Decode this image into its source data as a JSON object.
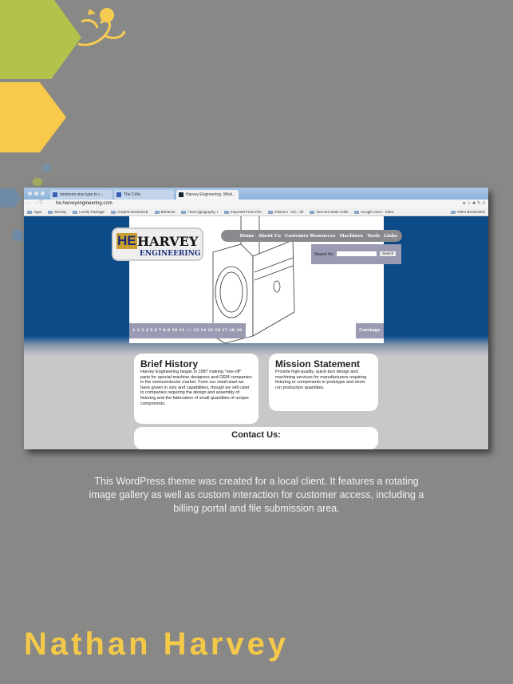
{
  "colors": {
    "background": "#888886",
    "green": "#b3c24b",
    "yellow": "#f8c94a",
    "blue": "#0c4a88"
  },
  "browser": {
    "tabs": [
      {
        "label": "minimum size type to r..."
      },
      {
        "label": "The Critic"
      },
      {
        "label": "Harvey Engineering, Wind..."
      }
    ],
    "url": "he.harveyengineering.com",
    "bookmarks": [
      "Apps",
      "Barclay",
      "Lovely Package",
      "Graphic-ExchanCE",
      "Behance",
      "I love typography, t",
      "Imported From Fire",
      "Volume I - DC : All",
      "Vermont State Colle",
      "Google Voice - Inbox",
      "Other Bookmarks"
    ]
  },
  "site": {
    "logo": {
      "initials": "HE",
      "name": "HARVEY",
      "sub": "ENGINEERING"
    },
    "nav": [
      "Home",
      "About Us",
      "Customer Resources",
      "Machines",
      "Tools",
      "Links"
    ],
    "search": {
      "label": "Search for:",
      "button": "Search",
      "value": ""
    },
    "gallery": {
      "pages": [
        "1",
        "2",
        "3",
        "4",
        "5",
        "6",
        "7",
        "8",
        "9",
        "10",
        "11",
        "12",
        "13",
        "14",
        "15",
        "16",
        "17",
        "18",
        "19"
      ],
      "current": "12",
      "caption": "Carriage"
    },
    "brief": {
      "title": "Brief History",
      "text": "Harvey Engineering began in 1987 making \"one-off\" parts for special-machine designers and OEM companies in the semiconductor market. From our small start we have grown in size and capabilities, though we still cater to companies requiring the design and assembly of fixturing and the fabrication of small quantities of unique components."
    },
    "mission": {
      "title": "Mission Statement",
      "text": "Provide high-quality, quick-turn design and machining services for manufacturers requiring fixturing or components in prototype and short-run production quantities."
    },
    "contact": {
      "title": "Contact Us:"
    }
  },
  "caption": "This WordPress theme was created for a local client. It features a rotating image gallery as well as custom interaction for customer access, including a billing portal and file submission area.",
  "author": "Nathan Harvey"
}
